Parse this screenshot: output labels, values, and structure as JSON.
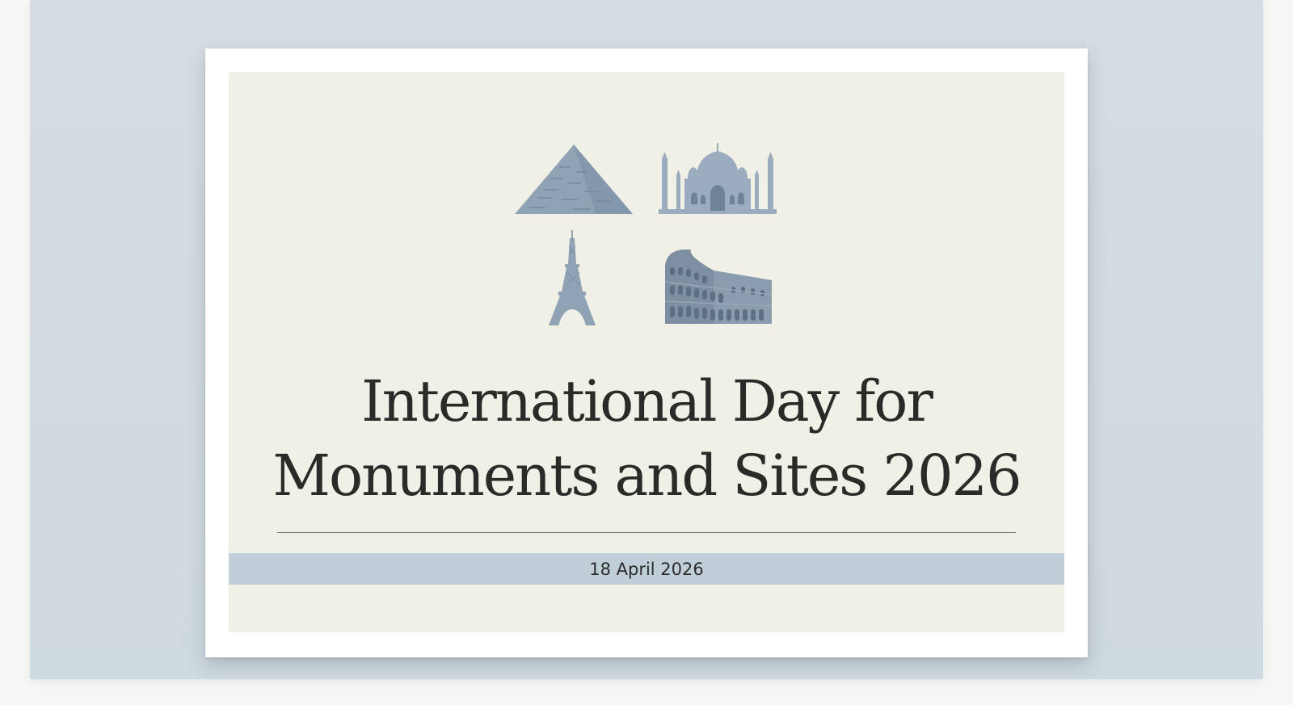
{
  "card": {
    "title_line1": "International Day for",
    "title_line2": "Monuments and Sites 2026",
    "date": "18 April 2026"
  },
  "icons": [
    "pyramid-icon",
    "taj-mahal-icon",
    "eiffel-tower-icon",
    "colosseum-icon"
  ],
  "colors": {
    "backdrop": "#d3dce2",
    "card_border": "#ffffff",
    "card_fill": "#f1f0e6",
    "date_band": "#c0ced8",
    "icon_blue": "#8fa3b5",
    "text": "#2a2a28"
  }
}
